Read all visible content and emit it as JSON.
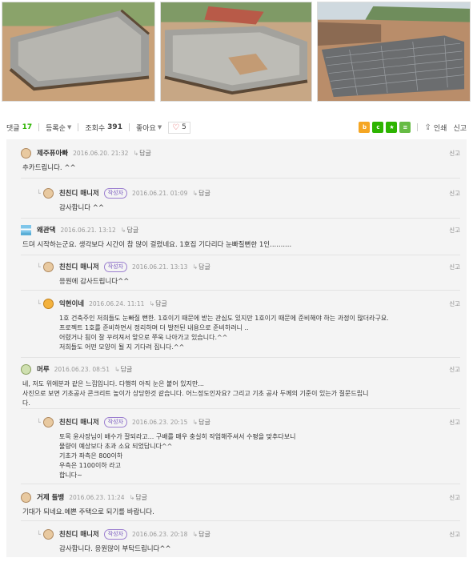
{
  "toolbar": {
    "comments_label": "댓글",
    "comments_count": "17",
    "sort_label": "등록순",
    "views_label": "조회수",
    "views_count": "391",
    "like_label": "좋아요",
    "heart_count": "5",
    "print_label": "인쇄",
    "report_label": "신고"
  },
  "comments": [
    {
      "nick": "제주퓨아빠",
      "date": "2016.06.20. 21:32",
      "reply": "답글",
      "report": "신고",
      "lines": [
        "추카드립니다. ^^"
      ]
    },
    {
      "nick": "친친디 매니저",
      "badge": "작성자",
      "date": "2016.06.21. 01:09",
      "reply": "답글",
      "report": "신고",
      "lines": [
        "감사합니다 ^^"
      ]
    },
    {
      "nick": "왜관댁",
      "date": "2016.06.21. 13:12",
      "reply": "답글",
      "report": "신고",
      "lines": [
        "드뎌 시작하는군요. 생각보다 시간이 참 많이 걸렸네요. 1호집 기다리다 눈빠질뻔한 1인.........."
      ]
    },
    {
      "nick": "친친디 매니저",
      "badge": "작성자",
      "date": "2016.06.21. 13:13",
      "reply": "답글",
      "report": "신고",
      "lines": [
        "응원에 감사드립니다^^"
      ]
    },
    {
      "nick": "익현이네",
      "date": "2016.06.24. 11:11",
      "reply": "답글",
      "report": "신고",
      "lines": [
        "1호 건축주인 저희들도 눈빠질 뻔한. 1호이기 때문에 받는 관심도 있지만 1호이기 때문에 준비해야 하는 과정이 많더라구요.",
        "프로젝트 1호를 준비하면서 정리하며 더 발전된 내용으로 준비하려니 ..",
        "어렸거나 됨이 잘 꾸려져서 앞으로 쭈욱 나아가고 있습니다.^^",
        "저희들도 어떤 모양이 될 지 기다려 집니다.^^"
      ]
    },
    {
      "nick": "머루",
      "date": "2016.06.23. 08:51",
      "reply": "답글",
      "report": "신고",
      "lines": [
        "네, 저도 위에분과 같은 느낌입니다. 다행히 아직 눈은 붙어 있지만...",
        "사진으로 보면 기초공사 콘크리트 높이가 상당한것 같습니다. 어느정도인자요? 그리고 기초 공사 두께의 기준이 있는가 질문드립니",
        "다."
      ]
    },
    {
      "nick": "친친디 매니저",
      "badge": "작성자",
      "date": "2016.06.23. 20:15",
      "reply": "답글",
      "report": "신고",
      "lines": [
        "토목 윤사장님이 배수가 잘되라고... 구배를 매우 충실히 작업해주셔서 수평을 맞추다보니",
        "물량이 예상보다 초과 소요 되었답니다^^",
        "기초가 좌측은 800이하",
        "우측은 1100이하 라고",
        "합니다~"
      ]
    },
    {
      "nick": "거제 들뱅",
      "date": "2016.06.23. 11:24",
      "reply": "답글",
      "report": "신고",
      "lines": [
        "기대가 되네요.예쁜 주택으로 되기를 바랍니다."
      ]
    },
    {
      "nick": "친친디 매니저",
      "badge": "작성자",
      "date": "2016.06.23. 20:18",
      "reply": "답글",
      "report": "신고",
      "lines": [
        "감사합니다. 응원많이 부탁드립니다^^"
      ]
    }
  ],
  "colors": {
    "accent": "#2db400",
    "badge": "#7b5cc0",
    "heart": "#e05050",
    "panel": "#f4f4f4"
  }
}
